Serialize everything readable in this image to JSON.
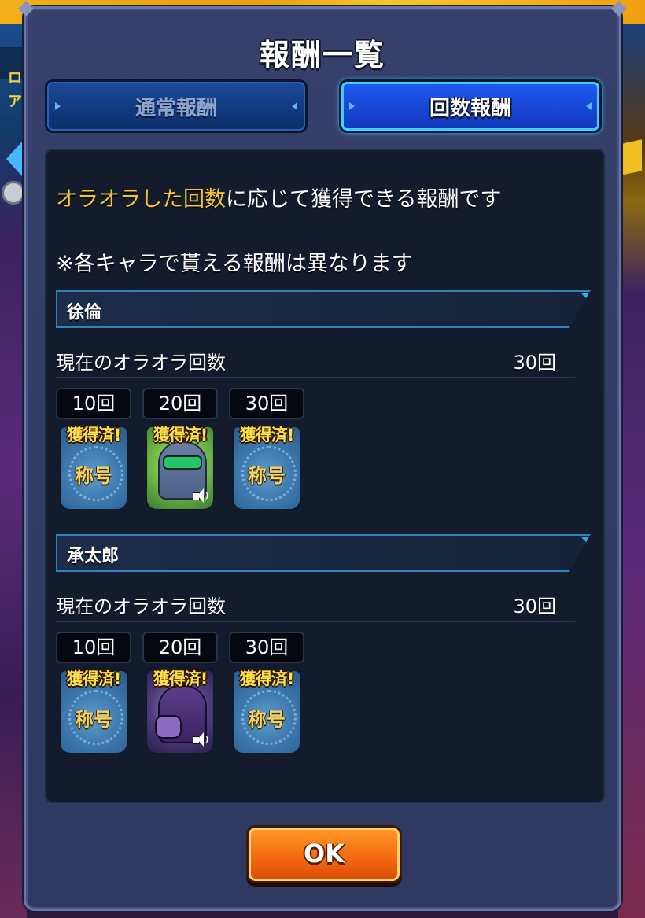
{
  "background": {
    "left_letters": [
      "ロ",
      "ア"
    ]
  },
  "dialog": {
    "title": "報酬一覧",
    "tabs": [
      {
        "label": "通常報酬",
        "active": false
      },
      {
        "label": "回数報酬",
        "active": true
      }
    ],
    "description_highlight": "オラオラした回数",
    "description_rest": "に応じて獲得できる報酬です",
    "note": "※各キャラで貰える報酬は異なります",
    "characters": [
      {
        "name": "徐倫",
        "count_label": "現在のオラオラ回数",
        "count_value": "30回",
        "rewards": [
          {
            "threshold": "10回",
            "status": "獲得済!",
            "type": "title",
            "card_text": "称号"
          },
          {
            "threshold": "20回",
            "status": "獲得済!",
            "type": "voice",
            "card_text": ""
          },
          {
            "threshold": "30回",
            "status": "獲得済!",
            "type": "title",
            "card_text": "称号"
          }
        ]
      },
      {
        "name": "承太郎",
        "count_label": "現在のオラオラ回数",
        "count_value": "30回",
        "rewards": [
          {
            "threshold": "10回",
            "status": "獲得済!",
            "type": "title",
            "card_text": "称号"
          },
          {
            "threshold": "20回",
            "status": "獲得済!",
            "type": "voice",
            "card_text": ""
          },
          {
            "threshold": "30回",
            "status": "獲得済!",
            "type": "title",
            "card_text": "称号"
          }
        ]
      }
    ],
    "ok_label": "OK"
  },
  "colors": {
    "highlight": "#f6c531",
    "obtained": "#ffe04a",
    "active_tab": "#1848d8",
    "ok_button": "#f56a10"
  }
}
